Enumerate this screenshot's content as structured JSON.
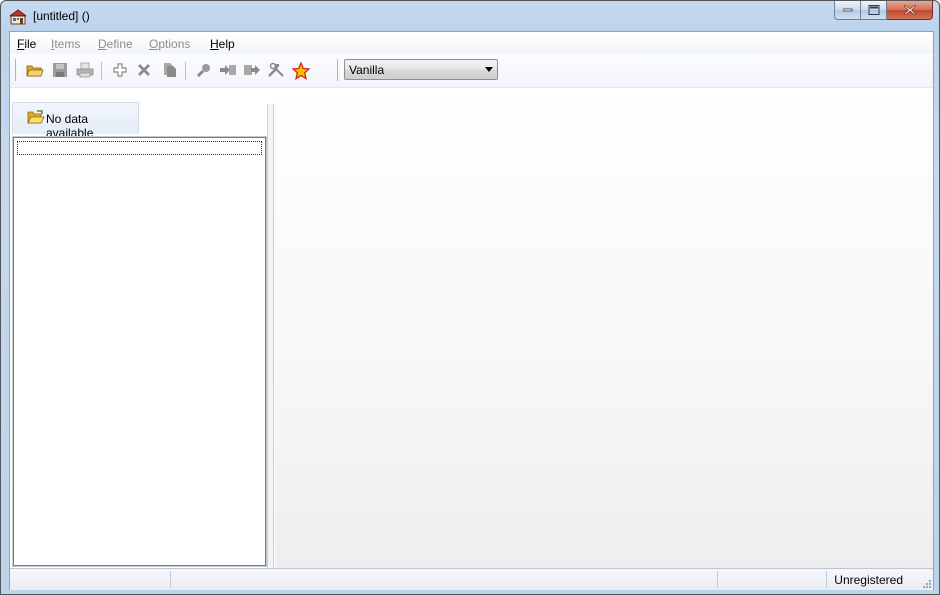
{
  "window": {
    "title": "[untitled] ()"
  },
  "menu": {
    "items": [
      {
        "label": "File",
        "access": "F",
        "rest": "ile",
        "enabled": true
      },
      {
        "label": "Items",
        "access": "I",
        "rest": "tems",
        "enabled": false
      },
      {
        "label": "Define",
        "access": "D",
        "rest": "efine",
        "enabled": false
      },
      {
        "label": "Options",
        "access": "O",
        "rest": "ptions",
        "enabled": false
      },
      {
        "label": "Help",
        "access": "H",
        "rest": "elp",
        "enabled": true
      }
    ]
  },
  "toolbar": {
    "buttons": [
      {
        "icon": "open-folder-icon",
        "enabled": true
      },
      {
        "icon": "save-icon",
        "enabled": false
      },
      {
        "icon": "print-icon",
        "enabled": false
      },
      {
        "icon": "add-icon",
        "enabled": false
      },
      {
        "icon": "delete-icon",
        "enabled": false
      },
      {
        "icon": "copy-icon",
        "enabled": false
      },
      {
        "icon": "find-icon",
        "enabled": false
      },
      {
        "icon": "import-icon",
        "enabled": false
      },
      {
        "icon": "export-icon",
        "enabled": false
      },
      {
        "icon": "tools-icon",
        "enabled": false
      },
      {
        "icon": "favorite-star-icon",
        "enabled": true
      }
    ],
    "theme_combo": {
      "selected": "Vanilla"
    }
  },
  "left_pane": {
    "tab_label": "No data available"
  },
  "statusbar": {
    "registration": "Unregistered"
  },
  "colors": {
    "frame": "#bcd3ec",
    "close_button": "#c3472c",
    "star": "#f5c400",
    "folder": "#f2c94c"
  }
}
